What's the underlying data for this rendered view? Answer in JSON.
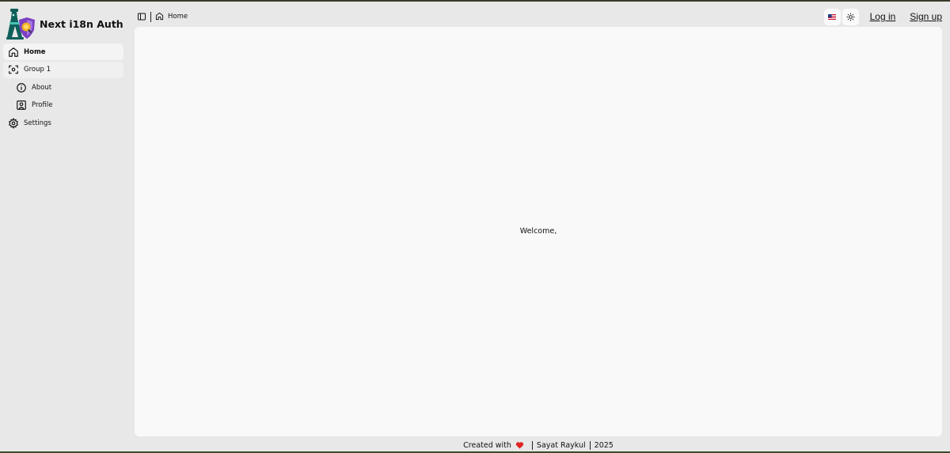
{
  "app": {
    "title": "Next i18n Auth"
  },
  "sidebar": {
    "items": [
      {
        "label": "Home",
        "icon": "home-icon"
      },
      {
        "label": "Group 1",
        "icon": "scan-icon"
      },
      {
        "label": "About",
        "icon": "info-icon"
      },
      {
        "label": "Profile",
        "icon": "user-square-icon"
      },
      {
        "label": "Settings",
        "icon": "gear-icon"
      }
    ]
  },
  "header": {
    "breadcrumb": "Home",
    "login_label": "Log in",
    "signup_label": "Sign up"
  },
  "main": {
    "message": "Welcome,"
  },
  "footer": {
    "created_with": "Created with",
    "author": "Sayat Raykul",
    "year": "2025"
  },
  "colors": {
    "background": "#e8e8e8",
    "panel": "#f9f9f9",
    "heart": "#e02424",
    "logo_teal": "#0f5f5a",
    "logo_purple": "#7a3fc2"
  }
}
